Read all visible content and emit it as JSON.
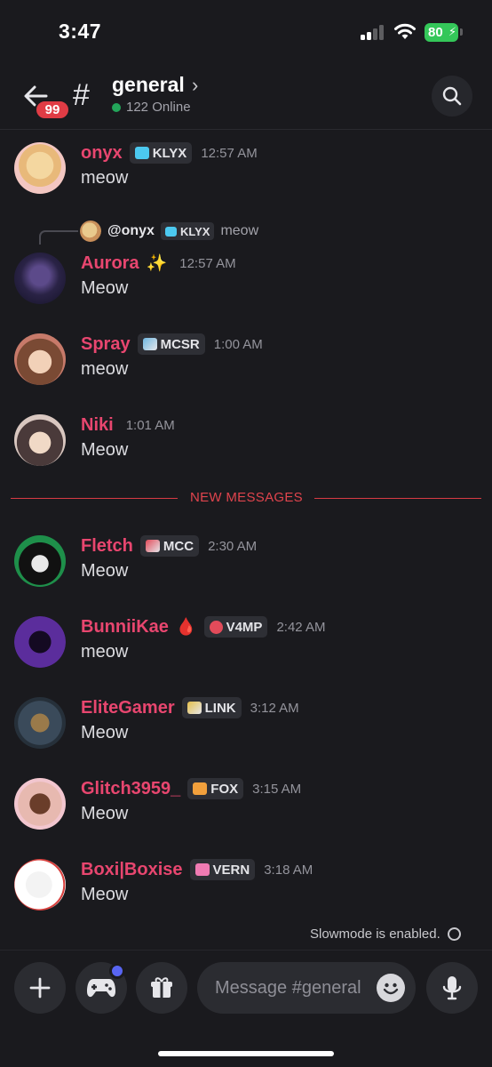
{
  "status_bar": {
    "time": "3:47",
    "battery": "80"
  },
  "header": {
    "unread_badge": "99",
    "channel_name": "general",
    "online_count": "122 Online"
  },
  "reply": {
    "user": "@onyx",
    "tag": "KLYX",
    "text": "meow"
  },
  "divider_label": "NEW MESSAGES",
  "messages": [
    {
      "username": "onyx",
      "tag": "KLYX",
      "time": "12:57 AM",
      "text": "meow"
    },
    {
      "username": "Aurora",
      "emoji": "✨",
      "time": "12:57 AM",
      "text": "Meow"
    },
    {
      "username": "Spray",
      "tag": "MCSR",
      "time": "1:00 AM",
      "text": "meow"
    },
    {
      "username": "Niki",
      "time": "1:01 AM",
      "text": "Meow"
    },
    {
      "username": "Fletch",
      "tag": "MCC",
      "time": "2:30 AM",
      "text": "Meow"
    },
    {
      "username": "BunniiKae",
      "emoji": "🩸",
      "tag": "V4MP",
      "time": "2:42 AM",
      "text": "meow"
    },
    {
      "username": "EliteGamer",
      "tag": "LINK",
      "time": "3:12 AM",
      "text": "Meow"
    },
    {
      "username": "Glitch3959_",
      "tag": "FOX",
      "time": "3:15 AM",
      "text": "Meow"
    },
    {
      "username": "Boxi|Boxise",
      "tag": "VERN",
      "time": "3:18 AM",
      "text": "Meow"
    }
  ],
  "slowmode": "Slowmode is enabled.",
  "composer": {
    "placeholder": "Message #general"
  },
  "colors": {
    "username": "#e8466f",
    "accent_red": "#e03c45",
    "online": "#23a55a",
    "activity": "#5865f2"
  }
}
